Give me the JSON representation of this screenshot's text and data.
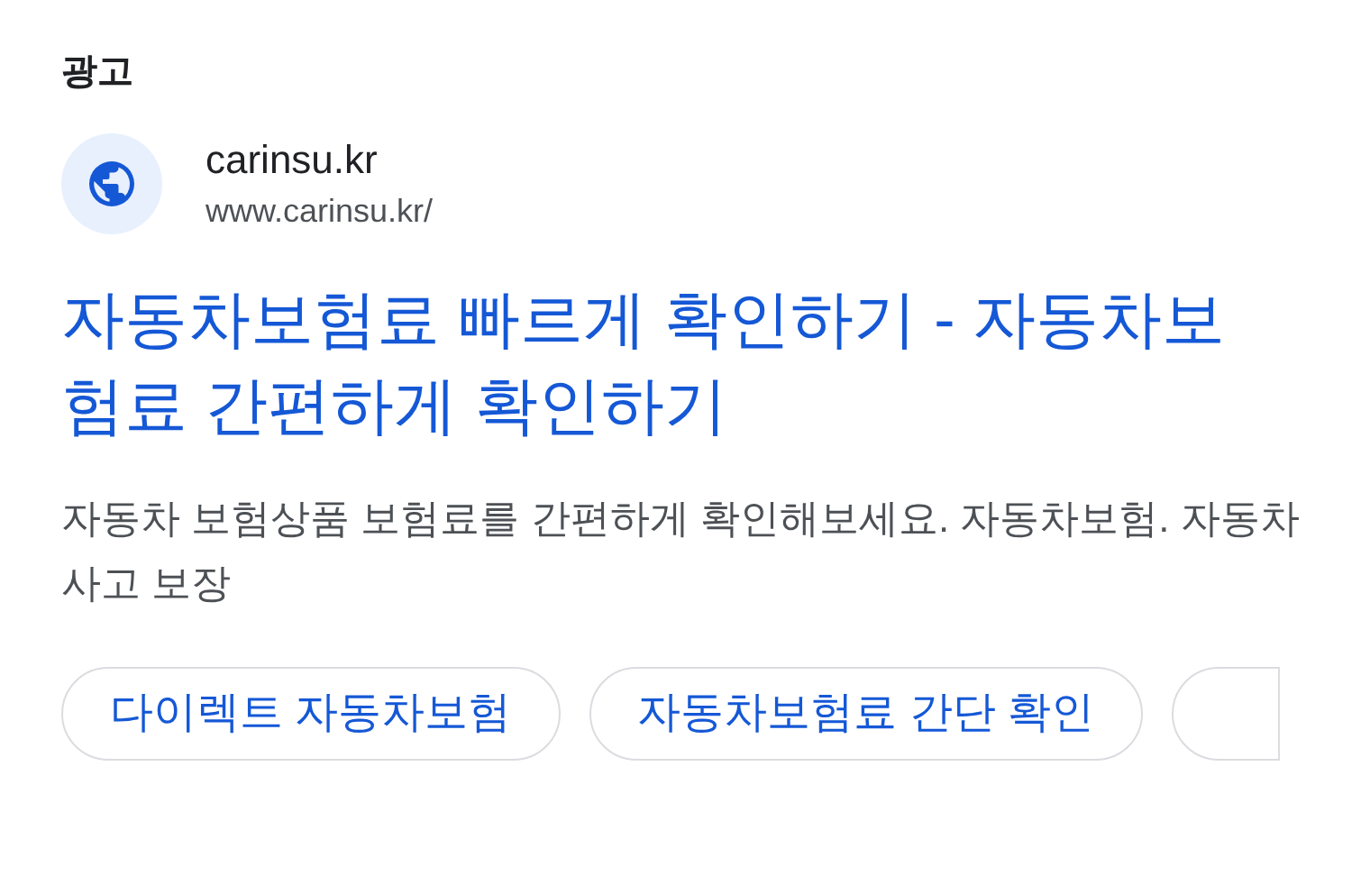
{
  "ad_label": "광고",
  "site": {
    "name": "carinsu.kr",
    "url": "www.carinsu.kr/"
  },
  "title": "자동차보험료 빠르게 확인하기 - 자동차보험료 간편하게 확인하기",
  "description": "자동차 보험상품 보험료를 간편하게 확인해보세요. 자동차보험. 자동차사고 보장",
  "chips": [
    {
      "label": "다이렉트 자동차보험"
    },
    {
      "label": "자동차보험료 간단 확인"
    }
  ],
  "more_chips": true
}
